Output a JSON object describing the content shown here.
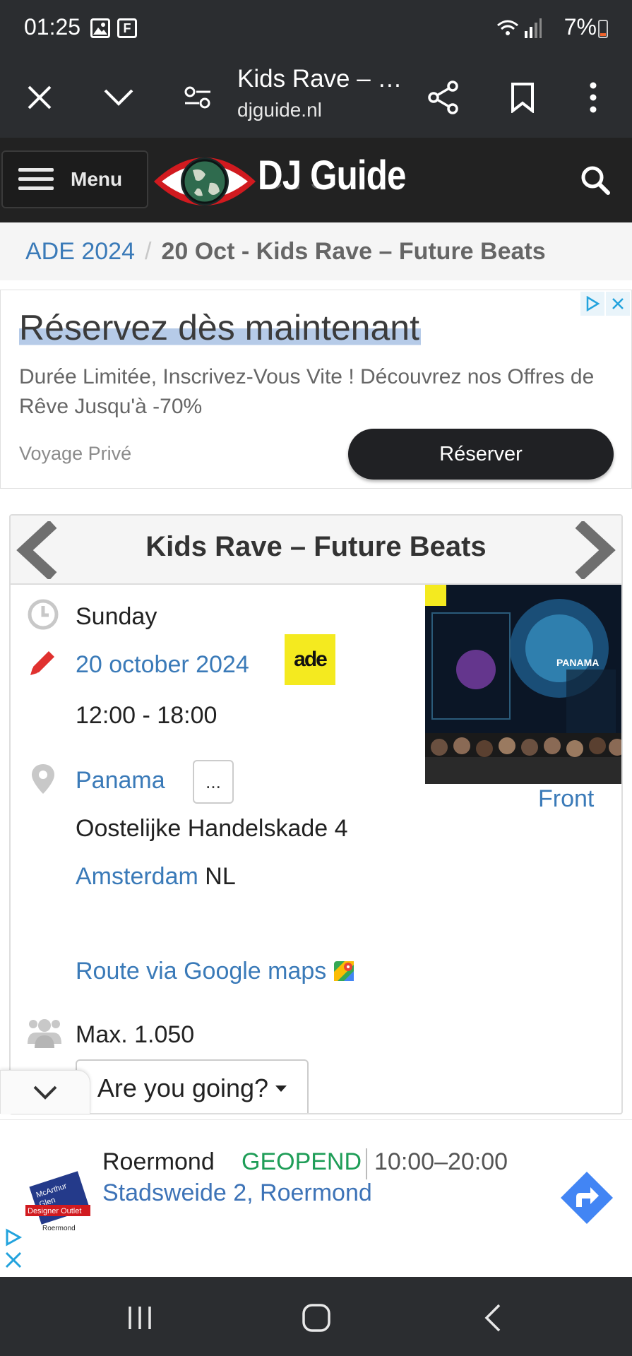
{
  "status_bar": {
    "time": "01:25",
    "battery": "7%"
  },
  "browser": {
    "page_title": "Kids Rave – …",
    "url": "djguide.nl"
  },
  "site_header": {
    "menu_label": "Menu",
    "logo_text": "DJ Guide"
  },
  "breadcrumb": {
    "parent": "ADE 2024",
    "separator": "/",
    "current": "20 Oct - Kids Rave – Future Beats"
  },
  "ad_top": {
    "headline": "Réservez dès maintenant",
    "description": "Durée Limitée, Inscrivez-Vous Vite ! Découvrez nos Offres de Rêve Jusqu'à -70%",
    "brand": "Voyage Privé",
    "cta": "Réserver"
  },
  "event": {
    "title": "Kids Rave – Future Beats",
    "day": "Sunday",
    "date": "20 october 2024",
    "badge": "ade",
    "time": "12:00 - 18:00",
    "venue": "Panama",
    "more": "...",
    "address": "Oostelijke Handelskade 4",
    "city": "Amsterdam",
    "country": "NL",
    "route": "Route via Google maps",
    "capacity": "Max. 1.050",
    "going_button": "Are you going?",
    "image_caption": "Front",
    "poster_text": "PANAMA"
  },
  "ad_bottom": {
    "name": "Roermond",
    "status": "GEOPEND",
    "hours": "10:00–20:00",
    "address": "Stadsweide 2, Roermond",
    "logo_line1": "McArthur",
    "logo_line2": "Glen",
    "logo_line3": "Designer Outlet",
    "logo_line4": "Roermond"
  },
  "colors": {
    "dark_bar": "#2b2d30",
    "link": "#3a7ab8",
    "open_green": "#1e9d57",
    "ade_yellow": "#f4ea1f",
    "edit_red": "#e0312f",
    "logo_red": "#d11a1f"
  }
}
